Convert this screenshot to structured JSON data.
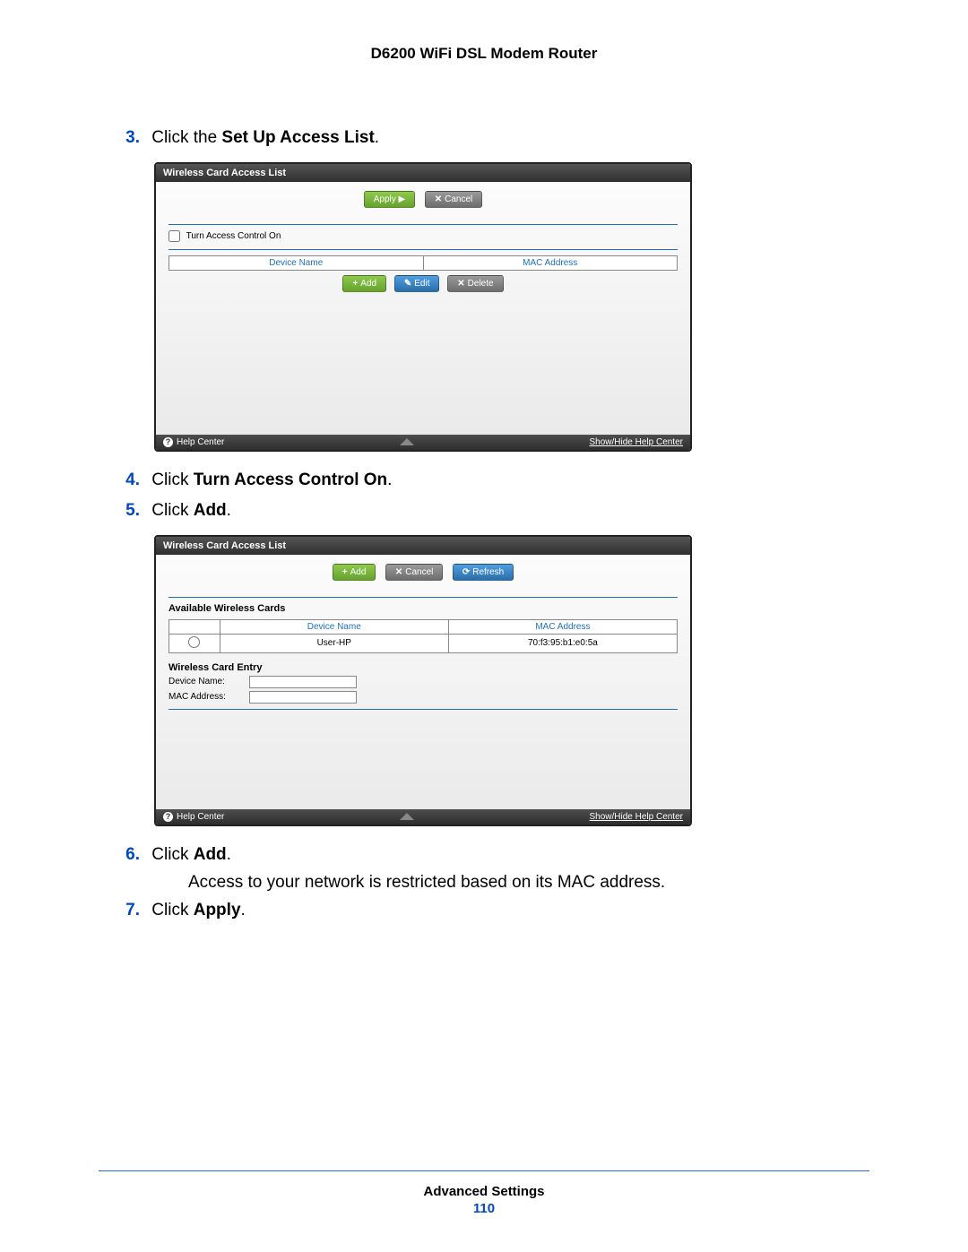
{
  "doc_title": "D6200 WiFi DSL Modem Router",
  "steps": {
    "s3": {
      "num": "3.",
      "pre": "Click the ",
      "bold": "Set Up Access List",
      "post": "."
    },
    "s4": {
      "num": "4.",
      "pre": "Click ",
      "bold": "Turn Access Control On",
      "post": "."
    },
    "s5": {
      "num": "5.",
      "pre": "Click ",
      "bold": "Add",
      "post": "."
    },
    "s6": {
      "num": "6.",
      "pre": "Click ",
      "bold": "Add",
      "post": "."
    },
    "s6_sub": "Access to your network is restricted based on its MAC address.",
    "s7": {
      "num": "7.",
      "pre": "Click ",
      "bold": "Apply",
      "post": "."
    }
  },
  "panel1": {
    "title": "Wireless Card Access List",
    "apply": "Apply ▶",
    "cancel": "Cancel",
    "checkbox_label": "Turn Access Control On",
    "col_device": "Device Name",
    "col_mac": "MAC Address",
    "add": "Add",
    "edit": "Edit",
    "delete": "Delete",
    "help": "Help Center",
    "showhide": "Show/Hide Help Center"
  },
  "panel2": {
    "title": "Wireless Card Access List",
    "add": "Add",
    "cancel": "Cancel",
    "refresh": "Refresh",
    "avail": "Available Wireless Cards",
    "col_device": "Device Name",
    "col_mac": "MAC Address",
    "row_device": "User-HP",
    "row_mac": "70:f3:95:b1:e0:5a",
    "entry_label": "Wireless Card Entry",
    "device_name_label": "Device Name:",
    "mac_label": "MAC Address:",
    "help": "Help Center",
    "showhide": "Show/Hide Help Center"
  },
  "footer": {
    "section": "Advanced Settings",
    "page": "110"
  }
}
